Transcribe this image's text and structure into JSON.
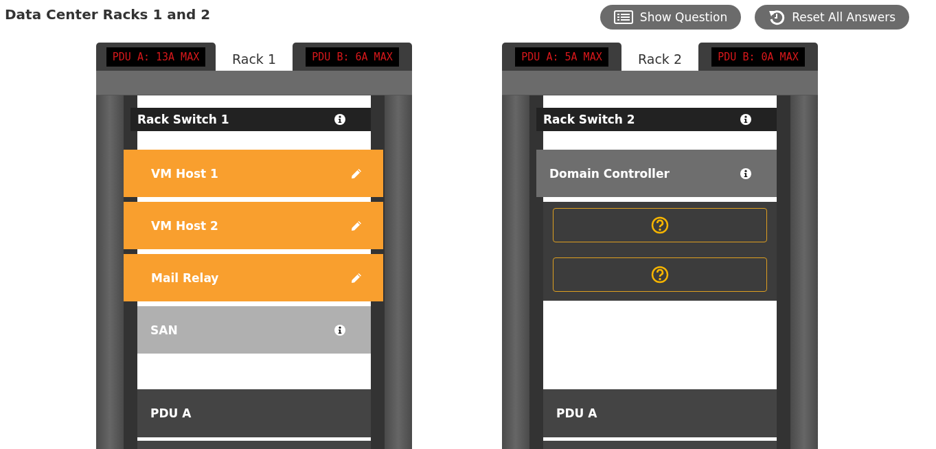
{
  "title": "Data Center Racks 1 and 2",
  "buttons": [
    {
      "label": "Show Question"
    },
    {
      "label": "Reset All Answers"
    }
  ],
  "racks": [
    {
      "name": "Rack 1",
      "pdu_a": "PDU A: 13A MAX",
      "pdu_b": "PDU B: 6A MAX",
      "slots": [
        {
          "kind": "switch",
          "label": "Rack Switch 1"
        },
        {
          "kind": "server",
          "label": "VM Host 1"
        },
        {
          "kind": "server",
          "label": "VM Host 2"
        },
        {
          "kind": "server",
          "label": "Mail Relay"
        },
        {
          "kind": "storage",
          "label": "SAN"
        },
        {
          "kind": "pdu",
          "label": "PDU A"
        }
      ]
    },
    {
      "name": "Rack 2",
      "pdu_a": "PDU A: 5A MAX",
      "pdu_b": "PDU B: 0A MAX",
      "slots": [
        {
          "kind": "switch",
          "label": "Rack Switch 2"
        },
        {
          "kind": "fixed",
          "label": "Domain Controller"
        },
        {
          "kind": "open"
        },
        {
          "kind": "open"
        },
        {
          "kind": "pdu",
          "label": "PDU A"
        }
      ]
    }
  ]
}
